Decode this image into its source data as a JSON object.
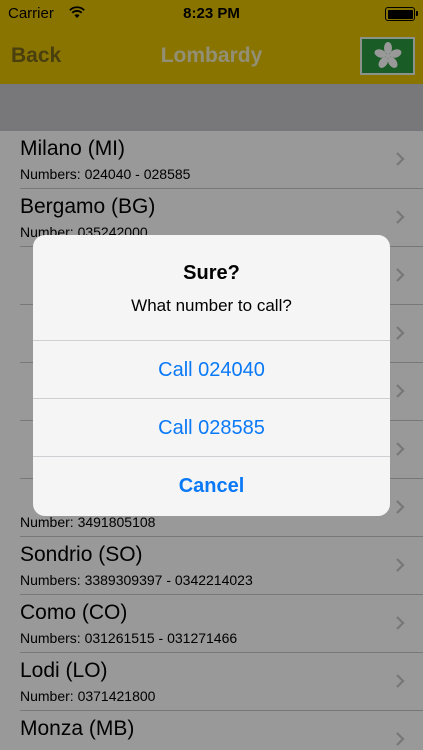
{
  "status_bar": {
    "carrier": "Carrier",
    "time": "8:23 PM",
    "battery_level": 1.0
  },
  "nav": {
    "back_label": "Back",
    "title": "Lombardy",
    "flag_icon": "lombardy-flag-icon",
    "bar_color": "#e6c200"
  },
  "cities": [
    {
      "name": "Milano (MI)",
      "numbers": "Numbers: 024040 - 028585"
    },
    {
      "name": "Bergamo (BG)",
      "numbers": "Number: 035242000"
    },
    {
      "name": "",
      "numbers": ""
    },
    {
      "name": "",
      "numbers": ""
    },
    {
      "name": "",
      "numbers": ""
    },
    {
      "name": "",
      "numbers": ""
    },
    {
      "name": "",
      "numbers": "Number: 3491805108"
    },
    {
      "name": "Sondrio (SO)",
      "numbers": "Numbers: 3389309397 - 0342214023"
    },
    {
      "name": "Como (CO)",
      "numbers": "Numbers: 031261515 - 031271466"
    },
    {
      "name": "Lodi (LO)",
      "numbers": "Number: 0371421800"
    },
    {
      "name": "Monza (MB)",
      "numbers": ""
    }
  ],
  "alert": {
    "title": "Sure?",
    "message": "What number to call?",
    "buttons": [
      "Call 024040",
      "Call 028585",
      "Cancel"
    ],
    "button_color": "#0a79f6"
  }
}
